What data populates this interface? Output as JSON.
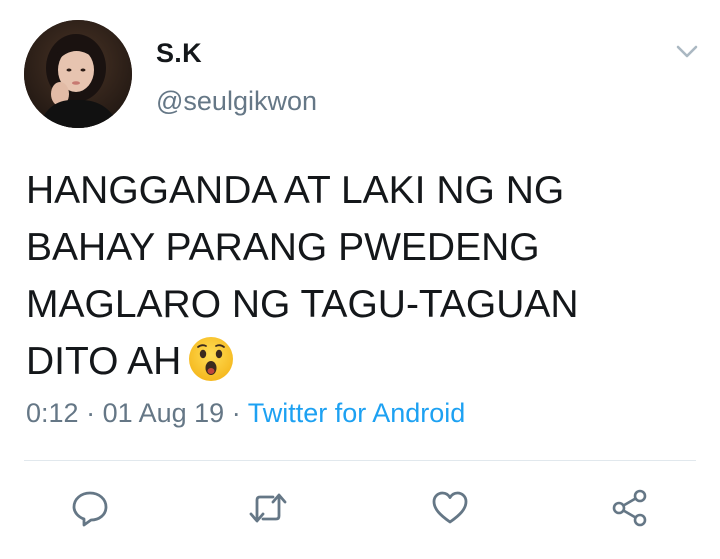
{
  "tweet": {
    "display_name": "S.K",
    "handle": "@seulgikwon",
    "text_lines": [
      "HANGGANDA AT LAKI NG NG",
      "BAHAY PARANG PWEDENG",
      "MAGLARO NG TAGU-TAGUAN",
      "DITO AH"
    ],
    "emoji": "astonished-face",
    "time": "0:12",
    "separator1": " · ",
    "date": "01 Aug 19",
    "separator2": " · ",
    "source": "Twitter for Android"
  },
  "icons": {
    "menu": "chevron-down-icon",
    "reply": "reply-icon",
    "retweet": "retweet-icon",
    "like": "heart-icon",
    "share": "share-icon"
  },
  "colors": {
    "text": "#14171a",
    "secondary": "#657786",
    "link": "#1da1f2",
    "icon": "#657786",
    "divider": "#e1e8ed"
  }
}
